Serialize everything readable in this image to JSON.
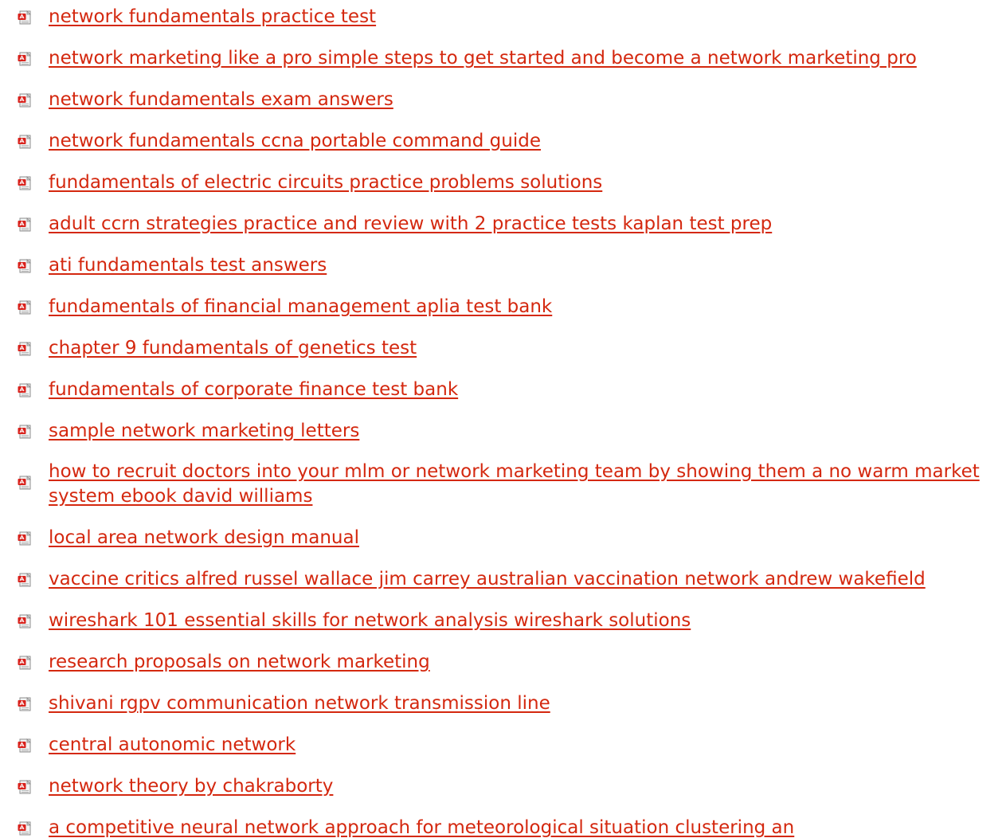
{
  "links": [
    {
      "label": "network fundamentals practice test",
      "icon": "pdf-icon"
    },
    {
      "label": "network marketing like a pro simple steps to get started and become a network marketing pro",
      "icon": "pdf-icon"
    },
    {
      "label": "network fundamentals exam answers",
      "icon": "pdf-icon"
    },
    {
      "label": "network fundamentals ccna portable command guide",
      "icon": "pdf-icon"
    },
    {
      "label": "fundamentals of electric circuits practice problems solutions",
      "icon": "pdf-icon"
    },
    {
      "label": "adult ccrn strategies practice and review with 2 practice tests kaplan test prep",
      "icon": "pdf-icon"
    },
    {
      "label": "ati fundamentals test answers",
      "icon": "pdf-icon"
    },
    {
      "label": "fundamentals of financial management aplia test bank",
      "icon": "pdf-icon"
    },
    {
      "label": "chapter 9 fundamentals of genetics test",
      "icon": "pdf-icon"
    },
    {
      "label": "fundamentals of corporate finance test bank",
      "icon": "pdf-icon"
    },
    {
      "label": "sample network marketing letters",
      "icon": "pdf-icon"
    },
    {
      "label": "how to recruit doctors into your mlm or network marketing team by showing them a no warm market system ebook david williams",
      "icon": "pdf-icon"
    },
    {
      "label": "local area network design manual",
      "icon": "pdf-icon"
    },
    {
      "label": "vaccine critics alfred russel wallace jim carrey australian vaccination network andrew wakefield",
      "icon": "pdf-icon"
    },
    {
      "label": "wireshark 101 essential skills for network analysis wireshark solutions",
      "icon": "pdf-icon"
    },
    {
      "label": "research proposals on network marketing",
      "icon": "pdf-icon"
    },
    {
      "label": "shivani rgpv communication network transmission line",
      "icon": "pdf-icon"
    },
    {
      "label": "central autonomic network",
      "icon": "pdf-icon"
    },
    {
      "label": "network theory by chakraborty",
      "icon": "pdf-icon"
    },
    {
      "label": "a competitive neural network approach for meteorological situation clustering an",
      "icon": "pdf-icon"
    }
  ],
  "colors": {
    "link": "#d4280f",
    "background": "#ffffff",
    "icon_red": "#d9221c",
    "icon_paper": "#f2f2f2"
  }
}
